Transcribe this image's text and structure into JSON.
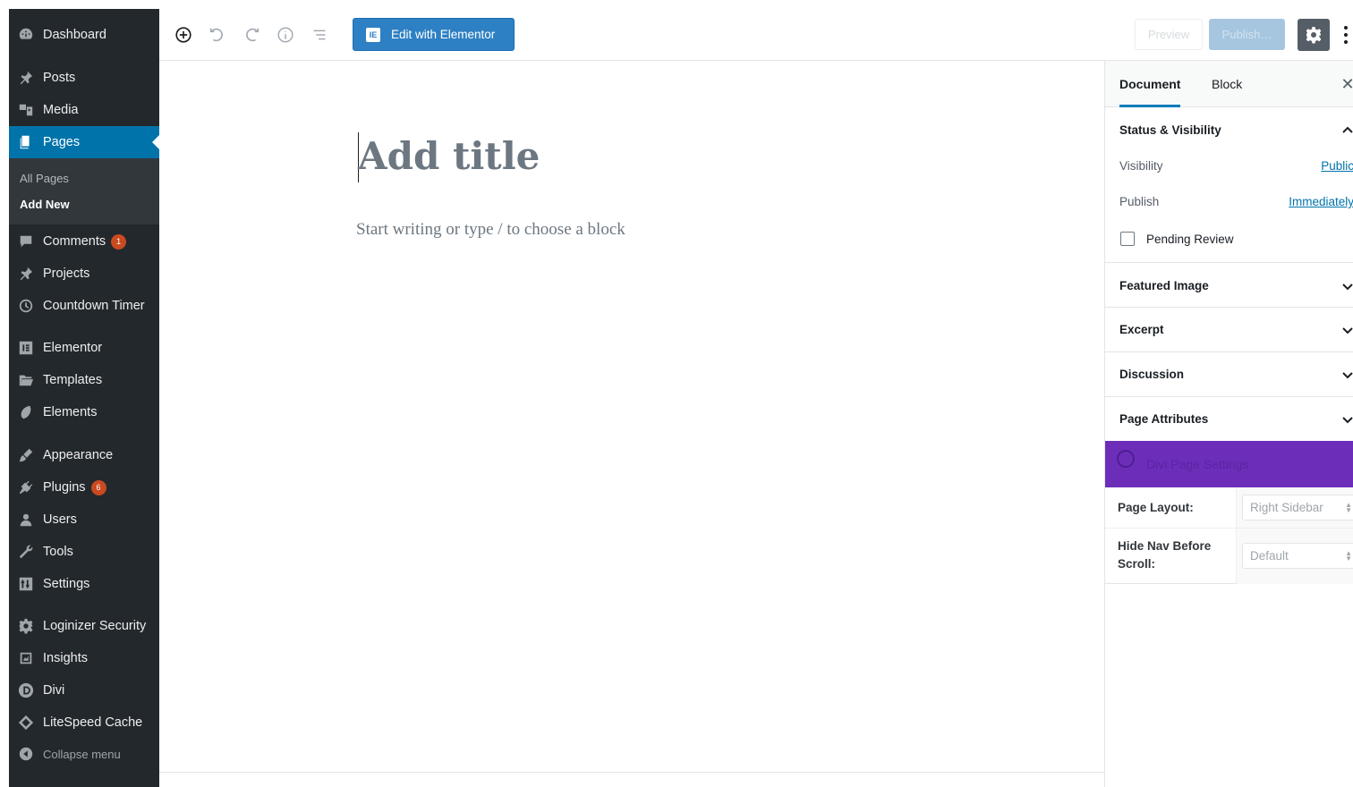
{
  "sidebar": {
    "items": [
      {
        "key": "dashboard",
        "label": "Dashboard",
        "icon": "dashboard-icon"
      },
      {
        "key": "posts",
        "label": "Posts",
        "icon": "pin-icon"
      },
      {
        "key": "media",
        "label": "Media",
        "icon": "media-icon"
      },
      {
        "key": "pages",
        "label": "Pages",
        "icon": "pages-icon"
      },
      {
        "key": "comments",
        "label": "Comments",
        "icon": "comment-icon",
        "badge": "1"
      },
      {
        "key": "projects",
        "label": "Projects",
        "icon": "pin-icon"
      },
      {
        "key": "countdown",
        "label": "Countdown Timer",
        "icon": "clock-icon"
      },
      {
        "key": "elementor",
        "label": "Elementor",
        "icon": "elementor-icon"
      },
      {
        "key": "templates",
        "label": "Templates",
        "icon": "folder-icon"
      },
      {
        "key": "elements",
        "label": "Elements",
        "icon": "leaf-icon"
      },
      {
        "key": "appearance",
        "label": "Appearance",
        "icon": "brush-icon"
      },
      {
        "key": "plugins",
        "label": "Plugins",
        "icon": "plugin-icon",
        "badge": "6"
      },
      {
        "key": "users",
        "label": "Users",
        "icon": "user-icon"
      },
      {
        "key": "tools",
        "label": "Tools",
        "icon": "wrench-icon"
      },
      {
        "key": "settings",
        "label": "Settings",
        "icon": "sliders-icon"
      },
      {
        "key": "loginizer",
        "label": "Loginizer Security",
        "icon": "gear-icon"
      },
      {
        "key": "insights",
        "label": "Insights",
        "icon": "insights-icon"
      },
      {
        "key": "divi",
        "label": "Divi",
        "icon": "divi-icon"
      },
      {
        "key": "litespeed",
        "label": "LiteSpeed Cache",
        "icon": "diamond-icon"
      }
    ],
    "submenu": {
      "all_pages": "All Pages",
      "add_new": "Add New"
    },
    "collapse_label": "Collapse menu"
  },
  "toolbar": {
    "elementor_button": "Edit with Elementor",
    "preview_label": "Preview",
    "publish_label": "Publish…"
  },
  "editor": {
    "title_placeholder": "Add title",
    "body_placeholder": "Start writing or type / to choose a block"
  },
  "panel": {
    "tabs": {
      "document": "Document",
      "block": "Block"
    },
    "status": {
      "title": "Status & Visibility",
      "visibility_label": "Visibility",
      "visibility_value": "Public",
      "publish_label": "Publish",
      "publish_value": "Immediately",
      "pending_review_label": "Pending Review",
      "pending_review_checked": false
    },
    "sections": {
      "featured_image": "Featured Image",
      "excerpt": "Excerpt",
      "discussion": "Discussion",
      "page_attributes": "Page Attributes"
    },
    "divi": {
      "title": "Divi Page Settings"
    },
    "meta": {
      "page_layout_label": "Page Layout:",
      "page_layout_value": "Right Sidebar",
      "hide_nav_label": "Hide Nav Before Scroll:",
      "hide_nav_value": "Default"
    }
  },
  "colors": {
    "admin_bg": "#23282d",
    "admin_active": "#0073aa",
    "elementor_blue": "#2d80c3",
    "divi_purple": "#6c2eb9",
    "link": "#0073aa"
  }
}
